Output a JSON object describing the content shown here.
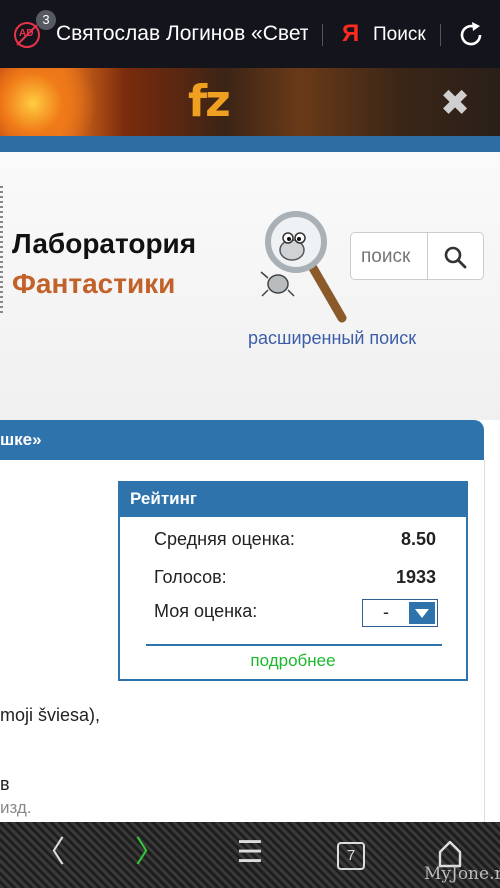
{
  "browser": {
    "tab_count": "3",
    "adblock_label": "AD",
    "tab_title": "Святослав Логинов «Свет в окошке»",
    "yandex_logo": "Я",
    "search_label": "Поиск"
  },
  "site": {
    "banner_logo": "fz",
    "close_glyph": "✖",
    "logo_line1": "Лаборатория",
    "logo_line2": "Фантастики",
    "search_placeholder": "поиск",
    "advanced_search": "расширенный поиск"
  },
  "work": {
    "title_fragment": "шке»"
  },
  "rating": {
    "header": "Рейтинг",
    "avg_label": "Средняя оценка:",
    "avg_value": "8.50",
    "votes_label": "Голосов:",
    "votes_value": "1933",
    "my_label": "Моя оценка:",
    "my_value": "-",
    "more_link": "подробнее"
  },
  "content": {
    "line1": "moji šviesa),",
    "line2": "в",
    "line3": "изд."
  },
  "bottom_nav": {
    "back": "〈",
    "forward": "〉",
    "menu": "☰",
    "tabs_count": "7",
    "watermark": "MyJone.ru"
  },
  "colors": {
    "accent_blue": "#2f73ad",
    "logo_orange": "#c2622a",
    "link_green": "#1db82e",
    "link_blue": "#3d5da8"
  }
}
